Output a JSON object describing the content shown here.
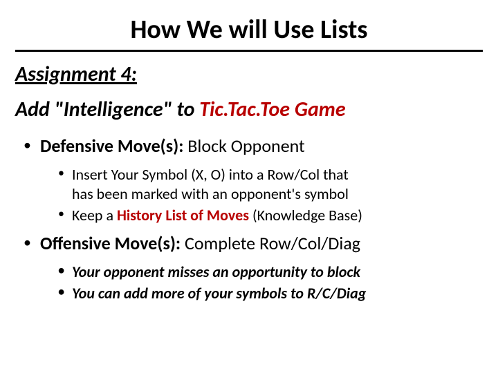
{
  "title": "How We will Use Lists",
  "assignment_label": "Assignment 4:",
  "subtitle_prefix": "Add \"Intelligence\" to ",
  "subtitle_red": "Tic.Tac.Toe Game",
  "defensive": {
    "label": "Defensive Move(s):",
    "text": "  Block Opponent",
    "sub1a": "Insert Your Symbol (X, O) into a Row/Col that",
    "sub1b": "has been marked with an opponent's symbol",
    "sub2_prefix": "Keep a ",
    "sub2_red": "History List of Moves",
    "sub2_suffix": " (Knowledge Base)"
  },
  "offensive": {
    "label": "Offensive Move(s):",
    "text": "   Complete Row/Col/Diag",
    "sub1": "Your opponent misses an opportunity to block",
    "sub2": "You can add more of your symbols to R/C/Diag"
  }
}
